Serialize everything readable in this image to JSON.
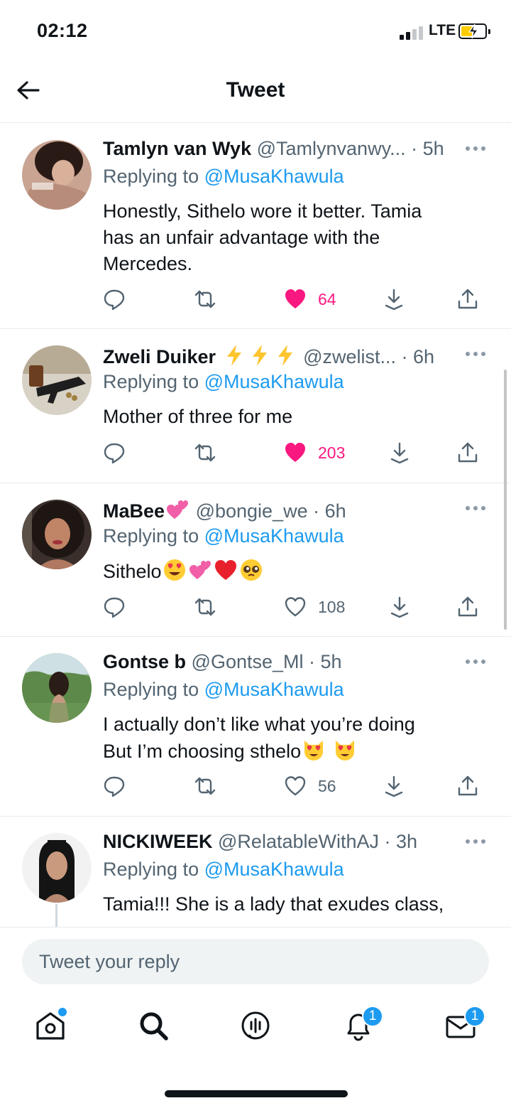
{
  "status_bar": {
    "time": "02:12",
    "network": "LTE"
  },
  "header": {
    "title": "Tweet"
  },
  "tweets": [
    {
      "name": "Tamlyn van Wyk",
      "handle": "@Tamlynvanwy...",
      "time": "5h",
      "replying_prefix": "Replying to",
      "replying_to": "@MusaKhawula",
      "text_lines": [
        "Honestly, Sithelo wore it better. Tamia",
        "has an unfair advantage with the",
        "Mercedes."
      ],
      "likes": "64",
      "liked": true
    },
    {
      "name": "Zweli Duiker",
      "handle": "@zwelist...",
      "time": "6h",
      "replying_prefix": "Replying to",
      "replying_to": "@MusaKhawula",
      "text_lines": [
        "Mother of three for me"
      ],
      "likes": "203",
      "liked": true
    },
    {
      "name": "MaBee",
      "handle": "@bongie_we",
      "time": "6h",
      "replying_prefix": "Replying to",
      "replying_to": "@MusaKhawula",
      "text_lines": [
        "Sithelo"
      ],
      "likes": "108",
      "liked": false
    },
    {
      "name": "Gontse b",
      "handle": "@Gontse_Ml",
      "time": "5h",
      "replying_prefix": "Replying to",
      "replying_to": "@MusaKhawula",
      "text_lines": [
        "I actually don’t like what you’re doing",
        "But I’m choosing sthelo"
      ],
      "likes": "56",
      "liked": false
    },
    {
      "name": "NICKIWEEK",
      "handle": "@RelatableWithAJ",
      "time": "3h",
      "replying_prefix": "Replying to",
      "replying_to": "@MusaKhawula",
      "text_lines": [
        "Tamia!!! She is a lady that exudes class,"
      ]
    }
  ],
  "composer": {
    "placeholder": "Tweet your reply"
  },
  "nav": {
    "notifications_badge": "1",
    "messages_badge": "1"
  },
  "colors": {
    "accent": "#1d9bf0",
    "like": "#f91880",
    "secondary_text": "#536471",
    "battery": "#ffcc00"
  },
  "icons": [
    "back-arrow-icon",
    "more-icon",
    "reply-icon",
    "retweet-icon",
    "heart-icon",
    "download-icon",
    "share-icon",
    "home-icon",
    "search-icon",
    "spaces-icon",
    "bell-icon",
    "mail-icon"
  ]
}
